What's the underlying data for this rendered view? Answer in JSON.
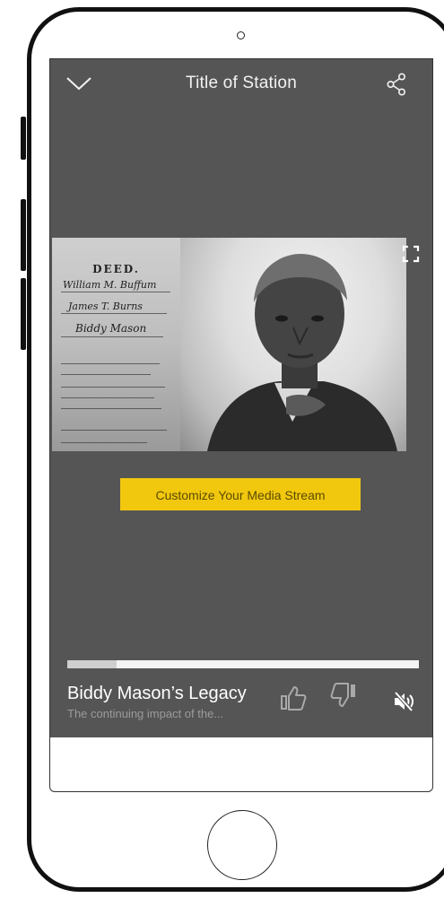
{
  "header": {
    "title": "Title of Station",
    "collapse_icon": "chevron-down-icon",
    "share_icon": "share-icon"
  },
  "media": {
    "deed_document": {
      "heading": "DEED.",
      "lines": [
        "William M. Buffum",
        "James T. Burns",
        "Biddy Mason"
      ]
    },
    "fullscreen_icon": "fullscreen-icon"
  },
  "customize_button": {
    "label": "Customize Your Media Stream"
  },
  "player": {
    "progress": 0.14,
    "title": "Biddy Mason’s Legacy",
    "subtitle": "The continuing impact of the...",
    "like_icon": "thumbs-up-icon",
    "dislike_icon": "thumbs-down-icon",
    "mute_icon": "volume-muted-icon"
  },
  "colors": {
    "screen_background": "#555556",
    "accent_button": "#f2c80f",
    "progress_track": "#f3f3f3",
    "progress_fill": "#cfcfcf",
    "title_text": "#ffffff",
    "subtitle_text": "#9b9b9b"
  }
}
